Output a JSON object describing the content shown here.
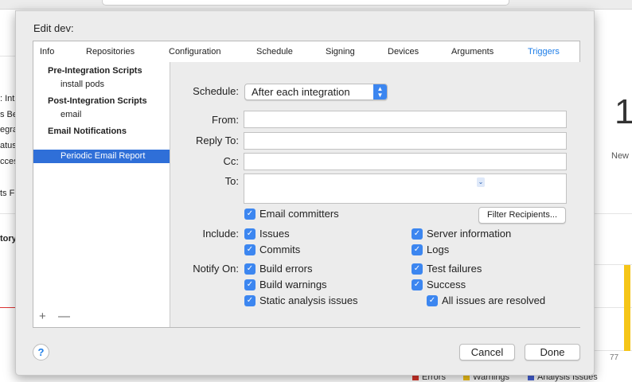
{
  "background": {
    "left_fragments": [
      ": Int",
      "s Bef",
      "egra",
      "atus",
      "ccess",
      "ts F",
      "tory"
    ],
    "big_number": "1",
    "new_label": "New",
    "axis_tick": "77",
    "legend": [
      {
        "label": "Errors",
        "color": "#d9352b"
      },
      {
        "label": "Warnings",
        "color": "#f5c518"
      },
      {
        "label": "Analysis Issues",
        "color": "#4561d8"
      }
    ]
  },
  "sheet": {
    "title": "Edit dev:",
    "tabs": [
      "Info",
      "Repositories",
      "Configuration",
      "Schedule",
      "Signing",
      "Devices",
      "Arguments",
      "Triggers"
    ],
    "active_tab": "Triggers"
  },
  "sidebar": {
    "sections": [
      {
        "header": "Pre-Integration Scripts",
        "items": [
          "install pods"
        ]
      },
      {
        "header": "Post-Integration Scripts",
        "items": [
          "email"
        ]
      },
      {
        "header": "Email Notifications",
        "items": [
          "Periodic Email Report"
        ]
      }
    ],
    "selected_item": "Periodic Email Report",
    "add_label": "+",
    "remove_label": "—"
  },
  "form": {
    "schedule_label": "Schedule:",
    "schedule_value": "After each integration",
    "from_label": "From:",
    "from_value": "",
    "reply_to_label": "Reply To:",
    "reply_to_value": "",
    "cc_label": "Cc:",
    "cc_value": "",
    "to_label": "To:",
    "to_value": "",
    "email_committers": {
      "label": "Email committers",
      "checked": true
    },
    "filter_recipients_button": "Filter Recipients...",
    "include_label": "Include:",
    "include": [
      {
        "label": "Issues",
        "checked": true
      },
      {
        "label": "Server information",
        "checked": true
      },
      {
        "label": "Commits",
        "checked": true
      },
      {
        "label": "Logs",
        "checked": true
      }
    ],
    "notify_label": "Notify On:",
    "notify": [
      {
        "label": "Build errors",
        "checked": true
      },
      {
        "label": "Test failures",
        "checked": true
      },
      {
        "label": "Build warnings",
        "checked": true
      },
      {
        "label": "Success",
        "checked": true
      },
      {
        "label": "Static analysis issues",
        "checked": true
      },
      {
        "label": "All issues are resolved",
        "checked": true
      }
    ]
  },
  "footer": {
    "help_label": "?",
    "cancel_label": "Cancel",
    "done_label": "Done"
  },
  "colors": {
    "accent": "#3c86f0",
    "selection": "#2f6fd8",
    "active_tab": "#1e7ee8"
  }
}
